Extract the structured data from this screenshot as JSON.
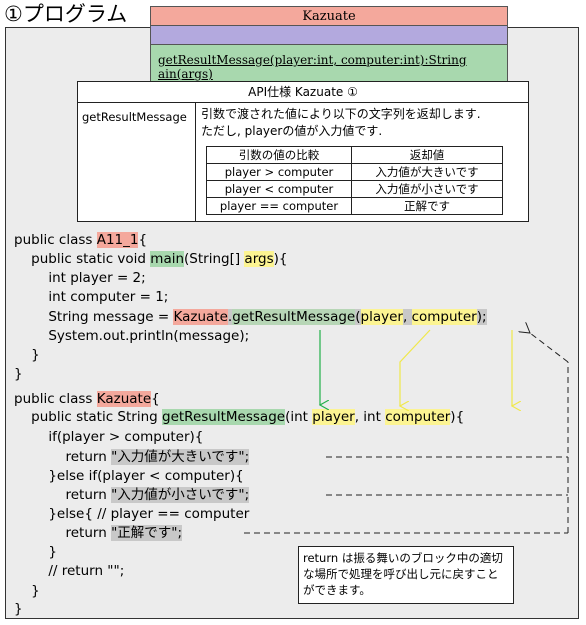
{
  "title": "①プログラム",
  "uml": {
    "class_name": "Kazuate",
    "operation": "getResultMessage(player:int, computer:int):String",
    "operation_partial": "ain(args)"
  },
  "api": {
    "title": "API仕様 Kazuate ①",
    "method": "getResultMessage",
    "desc_line1": "引数で渡された値により以下の文字列を返却します.",
    "desc_line2": "ただし, playerの値が入力値です.",
    "headers": [
      "引数の値の比較",
      "返却値"
    ],
    "rows": [
      {
        "cond": "player > computer",
        "ret": "入力値が大きいです"
      },
      {
        "cond": "player < computer",
        "ret": "入力値が小さいです"
      },
      {
        "cond": "player == computer",
        "ret": "正解です"
      }
    ]
  },
  "code": {
    "l1a": "public class ",
    "l1b": "A11_1",
    "l1c": "{",
    "l2a": "    public static void ",
    "l2b": "main",
    "l2c": "(String[] ",
    "l2d": "args",
    "l2e": "){",
    "l3": "        int player = 2;",
    "l4": "        int computer = 1;",
    "l5a": "        String message = ",
    "l5b": "Kazuate",
    "l5c": ".",
    "l5d": "getResultMessage",
    "l5e": "(",
    "l5f": "player",
    "l5g": ", ",
    "l5h": "computer",
    "l5i": ");",
    "l6": "        System.out.println(message);",
    "l7": "    }",
    "l8": "}",
    "l9a": "public class ",
    "l9b": "Kazuate",
    "l9c": "{",
    "l10a": "    public static String ",
    "l10b": "getResultMessage",
    "l10c": "(int ",
    "l10d": "player",
    "l10e": ", int ",
    "l10f": "computer",
    "l10g": "){",
    "l11": "        if(player > computer){",
    "l12a": "            return ",
    "l12b": "\"入力値が大きいです\";",
    "l13": "        }else if(player < computer){",
    "l14a": "            return ",
    "l14b": "\"入力値が小さいです\";",
    "l15": "        }else{ // player == computer",
    "l16a": "            return ",
    "l16b": "\"正解です\";",
    "l17": "        }",
    "l18": "        // return \"\";",
    "l19": "    }",
    "l20": "}"
  },
  "note": "return は振る舞いのブロック中の適切な場所で処理を呼び出し元に戻すことができます。",
  "colors": {
    "class_highlight": "#f4a89c",
    "method_highlight": "#a8d8ae",
    "param_highlight": "#fcf492",
    "return_highlight": "#c8c8c8",
    "uml_attr": "#b3a9de",
    "arrow_green": "#22b04a",
    "arrow_yellow": "#f0e84a"
  }
}
